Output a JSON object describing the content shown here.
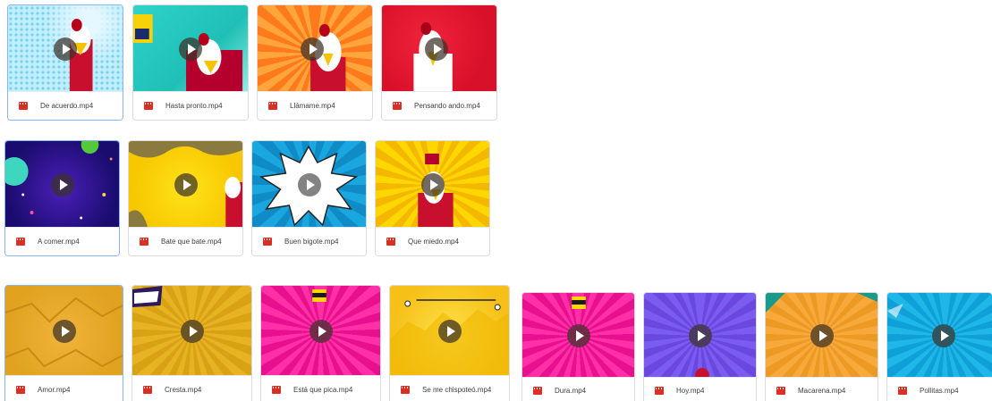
{
  "colors": {
    "file_icon": "#d93025",
    "selected_border": "#8ab4f8",
    "border": "#dadce0",
    "text": "#3c4043"
  },
  "icons": {
    "file": "video-file-icon",
    "play": "play-icon"
  },
  "files": [
    {
      "name": "De acuerdo.mp4",
      "theme": "halftone-blue",
      "selected": true
    },
    {
      "name": "Hasta pronto.mp4",
      "theme": "teal"
    },
    {
      "name": "Llámame.mp4",
      "theme": "orange-burst"
    },
    {
      "name": "Pensando ando.mp4",
      "theme": "red"
    },
    {
      "name": "A comer.mp4",
      "theme": "space",
      "selected": true
    },
    {
      "name": "Bate que bate.mp4",
      "theme": "yellow-pop"
    },
    {
      "name": "Buen bigote.mp4",
      "theme": "blue-burst"
    },
    {
      "name": "Que miedo.mp4",
      "theme": "yellow-burst"
    },
    {
      "name": "Amor.mp4",
      "theme": "mustard",
      "selected": true
    },
    {
      "name": "Cresta.mp4",
      "theme": "mustard-rays"
    },
    {
      "name": "Está que pica.mp4",
      "theme": "magenta"
    },
    {
      "name": "Se me chispoteó.mp4",
      "theme": "yellow-comic"
    },
    {
      "name": "Dura.mp4",
      "theme": "magenta-2"
    },
    {
      "name": "Hoy.mp4",
      "theme": "purple"
    },
    {
      "name": "Macarena.mp4",
      "theme": "orange-rays"
    },
    {
      "name": "Pollitas.mp4",
      "theme": "cyan"
    }
  ]
}
